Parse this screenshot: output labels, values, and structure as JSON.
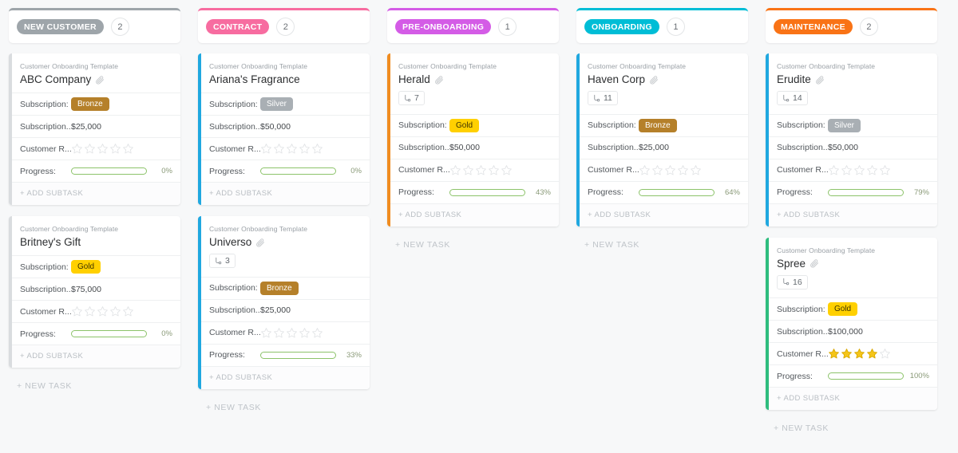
{
  "board": {
    "new_task_label": "+ NEW TASK",
    "add_subtask_label": "+ ADD SUBTASK",
    "template_label": "Customer Onboarding Template",
    "field_labels": {
      "subscription": "Subscription:",
      "subscription_value": "Subscription...",
      "customer_rating": "Customer R...",
      "progress": "Progress:"
    },
    "colors": {
      "new_customer": "#9ea5aa",
      "contract": "#f76ca0",
      "pre_onboarding": "#d45ce6",
      "onboarding": "#00bdd6",
      "maintenance": "#f97316",
      "bronze": "#b5802a",
      "silver": "#a9afb4",
      "gold": "#ffd000",
      "progress_fill": "#4cc24c",
      "star_filled": "#f5c518",
      "star_empty": "#e2e4e6"
    },
    "columns": [
      {
        "status": "NEW CUSTOMER",
        "status_color": "#9ea5aa",
        "count": "2",
        "show_new_task": true,
        "cards": [
          {
            "template": "Customer Onboarding Template",
            "title": "ABC Company",
            "has_attachment": true,
            "accent": "#d9dcdf",
            "subtasks": null,
            "subscription_tier": "Bronze",
            "tier_color": "#b5802a",
            "subscription_value": "$25,000",
            "rating": 0,
            "progress": 0,
            "progress_label": "0%"
          },
          {
            "template": "Customer Onboarding Template",
            "title": "Britney's Gift",
            "has_attachment": false,
            "accent": "#d9dcdf",
            "subtasks": null,
            "subscription_tier": "Gold",
            "tier_color": "#ffd000",
            "subscription_value": "$75,000",
            "rating": 0,
            "progress": 0,
            "progress_label": "0%"
          }
        ]
      },
      {
        "status": "CONTRACT",
        "status_color": "#f76ca0",
        "count": "2",
        "show_new_task": true,
        "cards": [
          {
            "template": "Customer Onboarding Template",
            "title": "Ariana's Fragrance",
            "has_attachment": false,
            "accent": "#20a8e0",
            "subtasks": null,
            "subscription_tier": "Silver",
            "tier_color": "#a9afb4",
            "subscription_value": "$50,000",
            "rating": 0,
            "progress": 0,
            "progress_label": "0%"
          },
          {
            "template": "Customer Onboarding Template",
            "title": "Universo",
            "has_attachment": true,
            "accent": "#20a8e0",
            "subtasks": "3",
            "subscription_tier": "Bronze",
            "tier_color": "#b5802a",
            "subscription_value": "$25,000",
            "rating": 0,
            "progress": 33,
            "progress_label": "33%"
          }
        ]
      },
      {
        "status": "PRE-ONBOARDING",
        "status_color": "#d45ce6",
        "count": "1",
        "show_new_task": true,
        "cards": [
          {
            "template": "Customer Onboarding Template",
            "title": "Herald",
            "has_attachment": true,
            "accent": "#f08c20",
            "subtasks": "7",
            "subscription_tier": "Gold",
            "tier_color": "#ffd000",
            "subscription_value": "$50,000",
            "rating": 0,
            "progress": 43,
            "progress_label": "43%"
          }
        ]
      },
      {
        "status": "ONBOARDING",
        "status_color": "#00bdd6",
        "count": "1",
        "show_new_task": true,
        "cards": [
          {
            "template": "Customer Onboarding Template",
            "title": "Haven Corp",
            "has_attachment": true,
            "accent": "#20a8e0",
            "subtasks": "11",
            "subscription_tier": "Bronze",
            "tier_color": "#b5802a",
            "subscription_value": "$25,000",
            "rating": 0,
            "progress": 64,
            "progress_label": "64%"
          }
        ]
      },
      {
        "status": "MAINTENANCE",
        "status_color": "#f97316",
        "count": "2",
        "show_new_task": true,
        "cards": [
          {
            "template": "Customer Onboarding Template",
            "title": "Erudite",
            "has_attachment": true,
            "accent": "#20a8e0",
            "subtasks": "14",
            "subscription_tier": "Silver",
            "tier_color": "#a9afb4",
            "subscription_value": "$50,000",
            "rating": 0,
            "progress": 79,
            "progress_label": "79%"
          },
          {
            "template": "Customer Onboarding Template",
            "title": "Spree",
            "has_attachment": true,
            "accent": "#2ebd7e",
            "subtasks": "16",
            "subscription_tier": "Gold",
            "tier_color": "#ffd000",
            "subscription_value": "$100,000",
            "rating": 4,
            "progress": 100,
            "progress_label": "100%"
          }
        ]
      }
    ]
  }
}
